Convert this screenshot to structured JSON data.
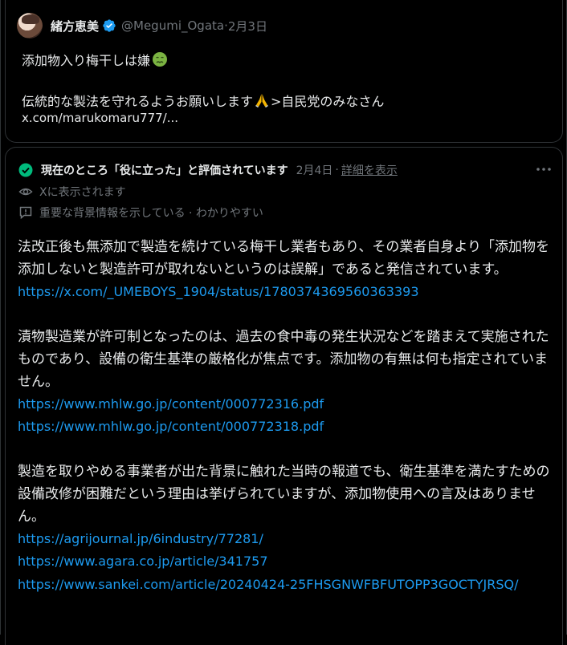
{
  "quoted_post": {
    "author_name": "緒方恵美",
    "handle": "@Megumi_Ogata",
    "meta_sep": " · ",
    "date": "2月3日",
    "line1": "添加物入り梅干しは嫌",
    "line2": "伝統的な製法を守れるようお願いします",
    "line2_suffix": ">自民党のみなさん",
    "link": "x.com/marukomaru777/..."
  },
  "note": {
    "title": "現在のところ「役に立った」と評価されています",
    "date": "2月4日",
    "details_label": "詳細を表示",
    "shown_on_x": "Xに表示されます",
    "tags": "重要な背景情報を示している · わかりやすい",
    "para1": "法改正後も無添加で製造を続けている梅干し業者もあり、その業者自身より「添加物を添加しないと製造許可が取れないというのは誤解」であると発信されています。",
    "link1": "https://x.com/_UMEBOYS_1904/status/1780374369560363393",
    "para2": "漬物製造業が許可制となったのは、過去の食中毒の発生状況などを踏まえて実施されたものであり、設備の衛生基準の厳格化が焦点です。添加物の有無は何も指定されていません。",
    "link2": "https://www.mhlw.go.jp/content/000772316.pdf",
    "link3": "https://www.mhlw.go.jp/content/000772318.pdf",
    "para3": "製造を取りやめる事業者が出た背景に触れた当時の報道でも、衛生基準を満たすための設備改修が困難だという理由は挙げられていますが、添加物使用への言及はありません。",
    "link4": "https://agrijournal.jp/6industry/77281/",
    "link5": "https://www.agara.co.jp/article/341757",
    "link6": "https://www.sankei.com/article/20240424-25FHSGNWFBFUTOPP3GOCTYJRSQ/"
  },
  "colors": {
    "background": "#000000",
    "text": "#e7e9ea",
    "muted": "#71767b",
    "link": "#1d9bf0",
    "verified": "#1d9bf0",
    "helpful_check": "#00ba7c"
  }
}
